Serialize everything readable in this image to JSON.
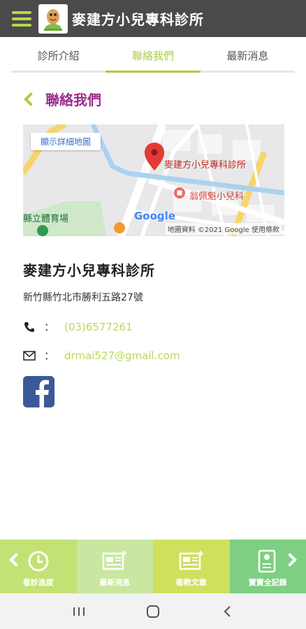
{
  "header": {
    "title": "麥建方小兒專科診所",
    "icons": {
      "menu": "hamburger-icon",
      "logo": "clinic-logo"
    }
  },
  "tabs": [
    {
      "label": "診所介紹",
      "active": false
    },
    {
      "label": "聯絡我們",
      "active": true
    },
    {
      "label": "最新消息",
      "active": false
    }
  ],
  "section": {
    "title": "聯絡我們"
  },
  "map": {
    "link_label": "顯示詳細地圖",
    "pin_label": "麥建方小兒專科診所",
    "poi_label": "翁佩魁小兒科",
    "road_label": "縣立體育場",
    "google_label": "Google",
    "attribution": "地圖資料 ©2021 Google   使用條款"
  },
  "clinic": {
    "name": "麥建方小兒專科診所",
    "address": "新竹縣竹北市勝利五路27號",
    "phone_colon": "：",
    "phone": "(03)6577261",
    "email_colon": "：",
    "email": "drmai527@gmail.com"
  },
  "bottom_nav": [
    {
      "label": "看診進度",
      "icon": "clock-icon"
    },
    {
      "label": "最新消息",
      "icon": "news-icon"
    },
    {
      "label": "衛教文章",
      "icon": "article-icon"
    },
    {
      "label": "寶寶全記錄",
      "icon": "record-icon"
    }
  ],
  "colors": {
    "header_bg": "#4a4a4a",
    "accent_green": "#a9cf3c",
    "section_title": "#9b2c8d",
    "link_green": "#b9da5a",
    "facebook_blue": "#3b5998"
  }
}
